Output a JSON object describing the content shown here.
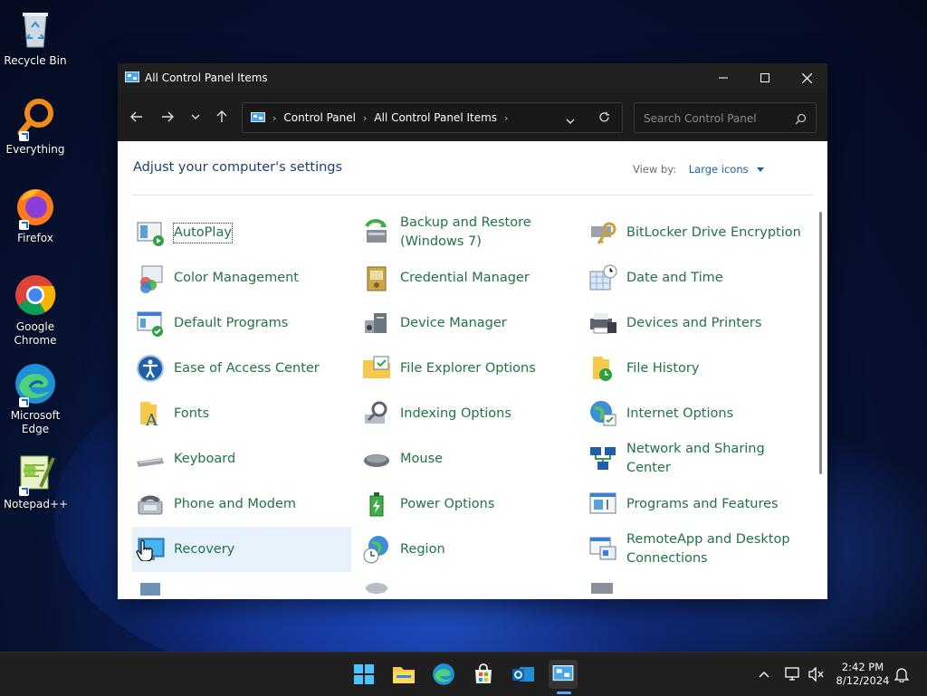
{
  "desktop": {
    "icons": [
      {
        "label": "Recycle Bin"
      },
      {
        "label": "Everything"
      },
      {
        "label": "Firefox"
      },
      {
        "label": "Google Chrome"
      },
      {
        "label": "Microsoft Edge"
      },
      {
        "label": "Notepad++"
      }
    ]
  },
  "window": {
    "title": "All Control Panel Items",
    "breadcrumb": [
      "Control Panel",
      "All Control Panel Items"
    ],
    "search_placeholder": "Search Control Panel"
  },
  "content": {
    "heading": "Adjust your computer's settings",
    "view_by_label": "View by:",
    "view_by_value": "Large icons",
    "items": [
      {
        "label": "AutoPlay"
      },
      {
        "label": "Backup and Restore (Windows 7)"
      },
      {
        "label": "BitLocker Drive Encryption"
      },
      {
        "label": "Color Management"
      },
      {
        "label": "Credential Manager"
      },
      {
        "label": "Date and Time"
      },
      {
        "label": "Default Programs"
      },
      {
        "label": "Device Manager"
      },
      {
        "label": "Devices and Printers"
      },
      {
        "label": "Ease of Access Center"
      },
      {
        "label": "File Explorer Options"
      },
      {
        "label": "File History"
      },
      {
        "label": "Fonts"
      },
      {
        "label": "Indexing Options"
      },
      {
        "label": "Internet Options"
      },
      {
        "label": "Keyboard"
      },
      {
        "label": "Mouse"
      },
      {
        "label": "Network and Sharing Center"
      },
      {
        "label": "Phone and Modem"
      },
      {
        "label": "Power Options"
      },
      {
        "label": "Programs and Features"
      },
      {
        "label": "Recovery"
      },
      {
        "label": "Region"
      },
      {
        "label": "RemoteApp and Desktop Connections"
      }
    ]
  },
  "taskbar": {
    "time": "2:42 PM",
    "date": "8/12/2024"
  },
  "colors": {
    "link_green": "#217344",
    "heading_blue": "#1e3f6e",
    "accent_blue": "#1a5fb4",
    "titlebar": "#202020"
  }
}
